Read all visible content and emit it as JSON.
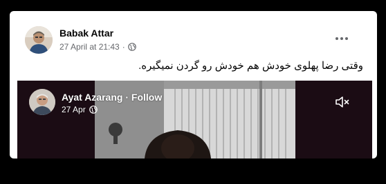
{
  "post": {
    "author": "Babak Attar",
    "timestamp": "27 April at 21:43",
    "separator": "·",
    "audience_icon": "globe-icon",
    "more_icon": "more-horizontal-icon",
    "text": "وقتی رضا پهلوی خودش هم خودش رو گردن نمیگیره."
  },
  "video": {
    "channel_name": "Ayat Azarang",
    "dot": "·",
    "follow_label": "Follow",
    "date": "27 Apr",
    "audience_icon": "globe-icon",
    "mute_icon": "speaker-muted-icon"
  },
  "colors": {
    "card_background": "#ffffff",
    "page_background": "#000000",
    "primary_text": "#050505",
    "secondary_text": "#65676b",
    "video_background": "#1b0c14"
  }
}
